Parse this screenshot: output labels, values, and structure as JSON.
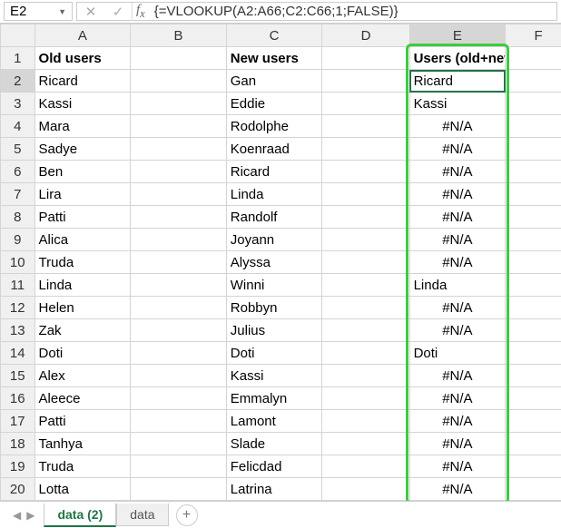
{
  "namebox": "E2",
  "formula": "{=VLOOKUP(A2:A66;C2:C66;1;FALSE)}",
  "columns": [
    "A",
    "B",
    "C",
    "D",
    "E",
    "F"
  ],
  "row_count": 20,
  "headers": {
    "A": "Old users",
    "C": "New users",
    "E": "Users (old+new)"
  },
  "rows": [
    {
      "n": 2,
      "A": "Ricard",
      "C": "Gan",
      "E": "Ricard"
    },
    {
      "n": 3,
      "A": "Kassi",
      "C": "Eddie",
      "E": "Kassi"
    },
    {
      "n": 4,
      "A": "Mara",
      "C": "Rodolphe",
      "E": "#N/A"
    },
    {
      "n": 5,
      "A": "Sadye",
      "C": "Koenraad",
      "E": "#N/A"
    },
    {
      "n": 6,
      "A": "Ben",
      "C": "Ricard",
      "E": "#N/A"
    },
    {
      "n": 7,
      "A": "Lira",
      "C": "Linda",
      "E": "#N/A"
    },
    {
      "n": 8,
      "A": "Patti",
      "C": "Randolf",
      "E": "#N/A"
    },
    {
      "n": 9,
      "A": "Alica",
      "C": "Joyann",
      "E": "#N/A"
    },
    {
      "n": 10,
      "A": "Truda",
      "C": "Alyssa",
      "E": "#N/A"
    },
    {
      "n": 11,
      "A": "Linda",
      "C": "Winni",
      "E": "Linda"
    },
    {
      "n": 12,
      "A": "Helen",
      "C": "Robbyn",
      "E": "#N/A"
    },
    {
      "n": 13,
      "A": "Zak",
      "C": "Julius",
      "E": "#N/A"
    },
    {
      "n": 14,
      "A": "Doti",
      "C": "Doti",
      "E": "Doti"
    },
    {
      "n": 15,
      "A": "Alex",
      "C": "Kassi",
      "E": "#N/A"
    },
    {
      "n": 16,
      "A": "Aleece",
      "C": "Emmalyn",
      "E": "#N/A"
    },
    {
      "n": 17,
      "A": "Patti",
      "C": "Lamont",
      "E": "#N/A"
    },
    {
      "n": 18,
      "A": "Tanhya",
      "C": "Slade",
      "E": "#N/A"
    },
    {
      "n": 19,
      "A": "Truda",
      "C": "Felicdad",
      "E": "#N/A"
    },
    {
      "n": 20,
      "A": "Lotta",
      "C": "Latrina",
      "E": "#N/A"
    }
  ],
  "selected_cell": "E2",
  "tabs": {
    "active": "data (2)",
    "others": [
      "data"
    ]
  }
}
